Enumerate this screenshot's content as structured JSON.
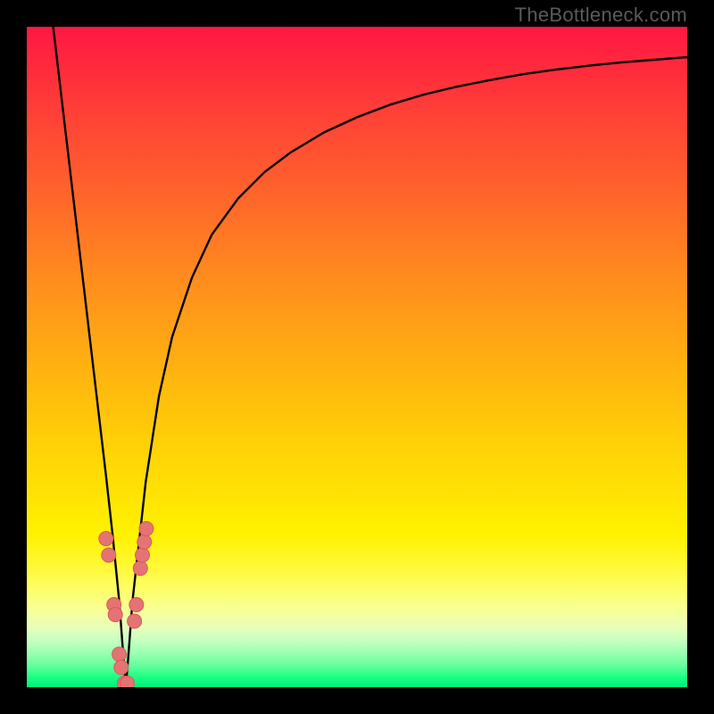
{
  "watermark": "TheBottleneck.com",
  "colors": {
    "background": "#000000",
    "curve_stroke": "#000000",
    "dot_fill": "#e57373",
    "dot_stroke": "#d85a5a",
    "gradient_top": "#ff1744",
    "gradient_mid": "#ffdd00",
    "gradient_bottom": "#00f07a"
  },
  "chart_data": {
    "type": "line",
    "title": "",
    "xlabel": "",
    "ylabel": "",
    "xlim": [
      0,
      100
    ],
    "ylim": [
      0,
      100
    ],
    "grid": false,
    "legend": false,
    "series": [
      {
        "name": "bottleneck-curve",
        "x": [
          4,
          6,
          8,
          10,
          12,
          13,
          14,
          14.6,
          15,
          15.4,
          16,
          18,
          20,
          22,
          25,
          28,
          32,
          36,
          40,
          45,
          50,
          55,
          60,
          65,
          70,
          75,
          80,
          85,
          90,
          95,
          100
        ],
        "y": [
          100,
          83,
          66,
          49,
          32,
          23,
          13,
          5,
          0,
          5,
          13,
          31,
          44,
          53,
          62,
          68.5,
          74,
          78,
          81,
          84,
          86.3,
          88.2,
          89.7,
          90.9,
          91.9,
          92.8,
          93.5,
          94.1,
          94.6,
          95.0,
          95.4
        ]
      }
    ],
    "points": [
      {
        "name": "left-marker-1",
        "x": 12.0,
        "y": 22.5
      },
      {
        "name": "left-marker-2",
        "x": 12.4,
        "y": 20.0
      },
      {
        "name": "left-marker-3",
        "x": 13.2,
        "y": 12.5
      },
      {
        "name": "left-marker-4",
        "x": 13.4,
        "y": 11.0
      },
      {
        "name": "left-marker-5",
        "x": 14.0,
        "y": 5.0
      },
      {
        "name": "left-marker-6",
        "x": 14.3,
        "y": 3.0
      },
      {
        "name": "vertex-marker-1",
        "x": 14.8,
        "y": 0.6
      },
      {
        "name": "vertex-marker-2",
        "x": 15.2,
        "y": 0.6
      },
      {
        "name": "right-marker-1",
        "x": 16.3,
        "y": 10.0
      },
      {
        "name": "right-marker-2",
        "x": 16.6,
        "y": 12.5
      },
      {
        "name": "right-marker-3",
        "x": 17.2,
        "y": 18.0
      },
      {
        "name": "right-marker-4",
        "x": 17.5,
        "y": 20.0
      },
      {
        "name": "right-marker-5",
        "x": 17.8,
        "y": 22.0
      },
      {
        "name": "right-marker-6",
        "x": 18.1,
        "y": 24.0
      }
    ]
  }
}
